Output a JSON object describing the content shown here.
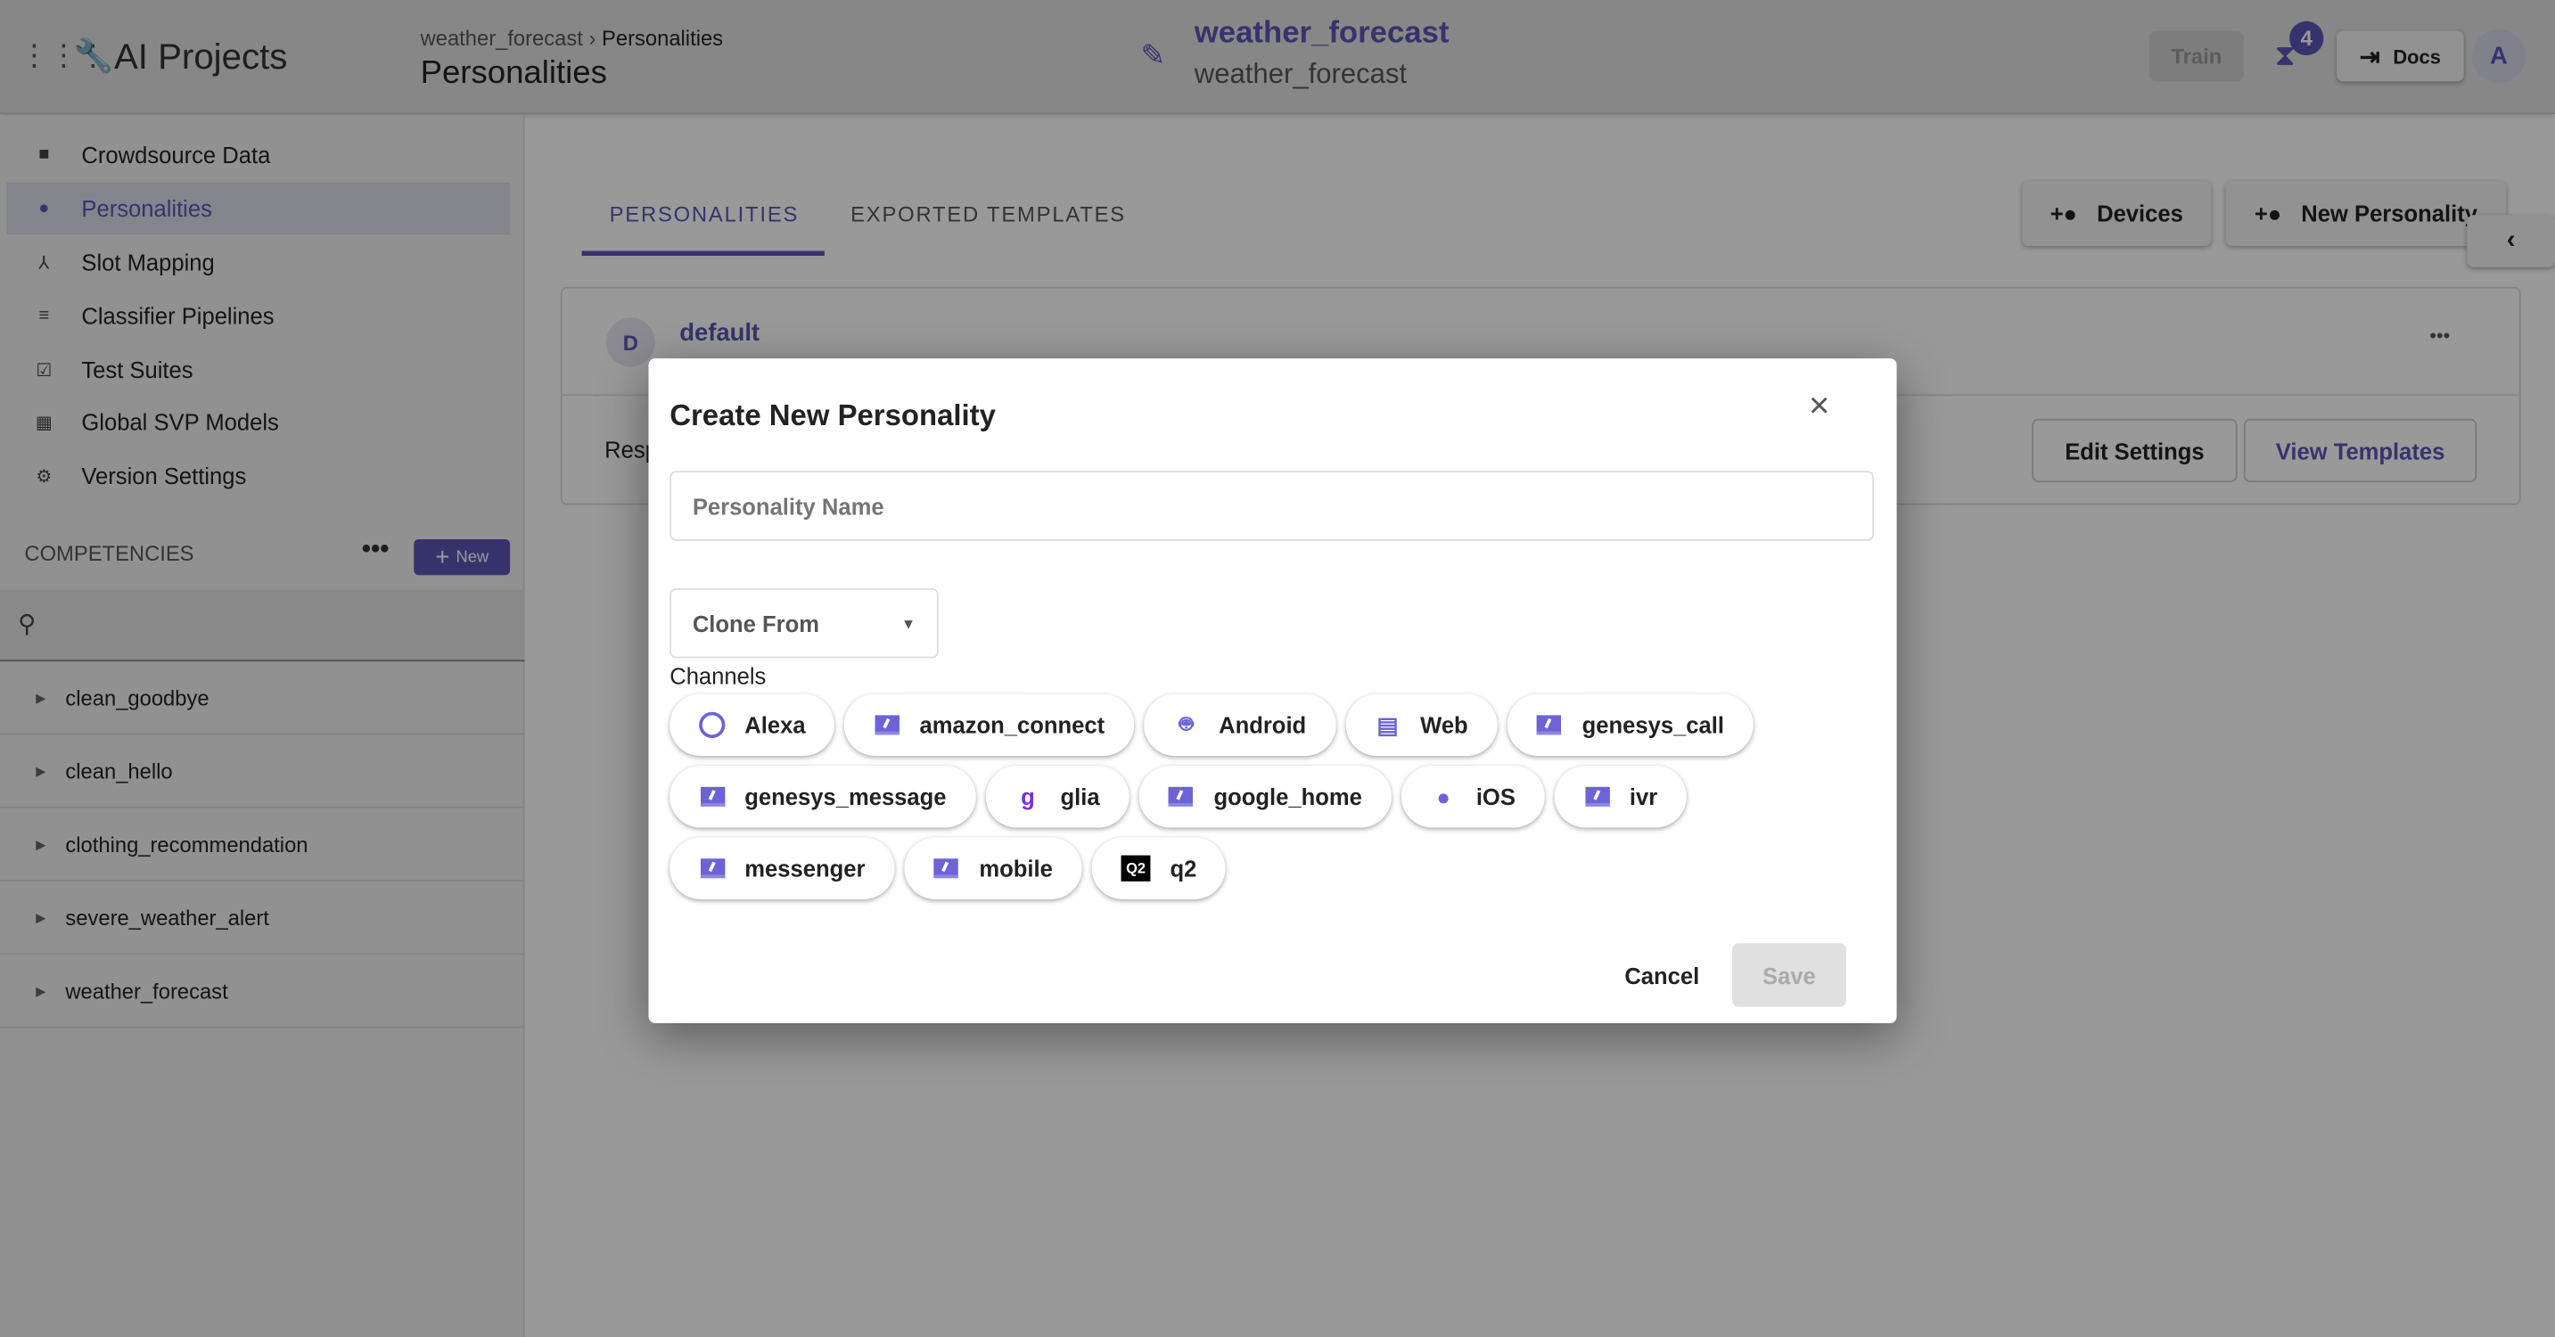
{
  "header": {
    "app_title": "AI Projects",
    "breadcrumb": [
      "weather_forecast",
      "Personalities"
    ],
    "page_title": "Personalities",
    "project_name": "weather_forecast",
    "project_subtitle": "weather_forecast",
    "train_label": "Train",
    "notification_count": "4",
    "docs_label": "Docs",
    "avatar_letter": "A"
  },
  "sidebar": {
    "items": [
      {
        "label": "Crowdsource Data",
        "icon": "chat-icon"
      },
      {
        "label": "Personalities",
        "icon": "person-icon",
        "active": true
      },
      {
        "label": "Slot Mapping",
        "icon": "merge-icon"
      },
      {
        "label": "Classifier Pipelines",
        "icon": "list-icon"
      },
      {
        "label": "Test Suites",
        "icon": "checkbox-icon"
      },
      {
        "label": "Global SVP Models",
        "icon": "grid-icon"
      },
      {
        "label": "Version Settings",
        "icon": "gear-icon"
      }
    ],
    "competencies_label": "COMPETENCIES",
    "new_label": "New",
    "competencies": [
      "clean_goodbye",
      "clean_hello",
      "clothing_recommendation",
      "severe_weather_alert",
      "weather_forecast"
    ]
  },
  "main": {
    "tabs": [
      {
        "label": "PERSONALITIES",
        "active": true
      },
      {
        "label": "EXPORTED TEMPLATES"
      }
    ],
    "devices_label": "Devices",
    "new_personality_label": "New Personality",
    "card": {
      "avatar": "D",
      "name": "default",
      "text": "Resp",
      "edit_label": "Edit Settings",
      "view_label": "View Templates"
    }
  },
  "modal": {
    "title": "Create New Personality",
    "name_placeholder": "Personality Name",
    "clone_label": "Clone From",
    "channels_label": "Channels",
    "channels": [
      [
        "Alexa",
        "amazon_connect",
        "Android",
        "Web",
        "genesys_call"
      ],
      [
        "genesys_message",
        "glia",
        "google_home",
        "iOS",
        "ivr"
      ],
      [
        "messenger",
        "mobile",
        "q2"
      ]
    ],
    "cancel_label": "Cancel",
    "save_label": "Save"
  },
  "colors": {
    "accent": "#5a55b5",
    "icon": "#6c63d9"
  }
}
